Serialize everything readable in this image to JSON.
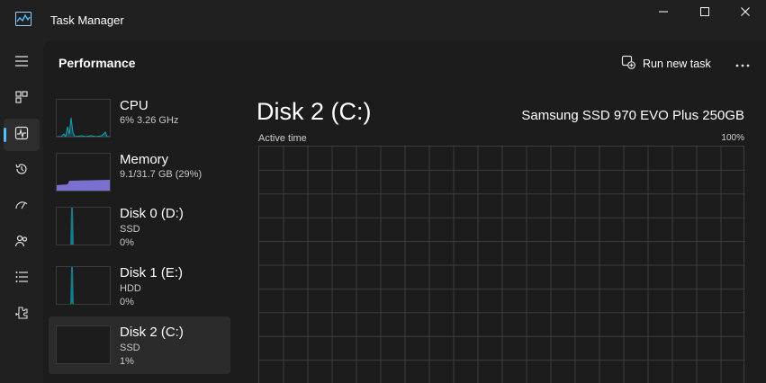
{
  "window": {
    "title": "Task Manager",
    "app_icon": "performance-chart-icon",
    "controls": [
      "minimize-icon",
      "maximize-icon",
      "close-icon"
    ]
  },
  "nav": {
    "items": [
      {
        "icon": "hamburger-menu-icon"
      },
      {
        "icon": "processes-icon"
      },
      {
        "icon": "performance-icon",
        "active": true
      },
      {
        "icon": "app-history-icon"
      },
      {
        "icon": "startup-apps-icon"
      },
      {
        "icon": "users-icon"
      },
      {
        "icon": "details-icon"
      },
      {
        "icon": "services-icon"
      }
    ],
    "accent_color": "#4cc2ff"
  },
  "header": {
    "title": "Performance",
    "run_task_label": "Run new task",
    "more_icon": "more-options-icon"
  },
  "devices": [
    {
      "name": "CPU",
      "lines": [
        "6%  3.26 GHz"
      ],
      "graph_color": "#17a2b8"
    },
    {
      "name": "Memory",
      "lines": [
        "9.1/31.7 GB (29%)"
      ],
      "graph_color": "#8a7ff0"
    },
    {
      "name": "Disk 0 (D:)",
      "lines": [
        "SSD",
        "0%"
      ],
      "graph_color": "#17a2b8"
    },
    {
      "name": "Disk 1 (E:)",
      "lines": [
        "HDD",
        "0%"
      ],
      "graph_color": "#17a2b8"
    },
    {
      "name": "Disk 2 (C:)",
      "lines": [
        "SSD",
        "1%"
      ],
      "graph_color": "#17a2b8",
      "selected": true
    }
  ],
  "detail": {
    "title": "Disk 2 (C:)",
    "model": "Samsung SSD 970 EVO Plus 250GB",
    "axis_label": "Active time",
    "axis_max": "100%",
    "grid_color": "#3d3d3d"
  }
}
